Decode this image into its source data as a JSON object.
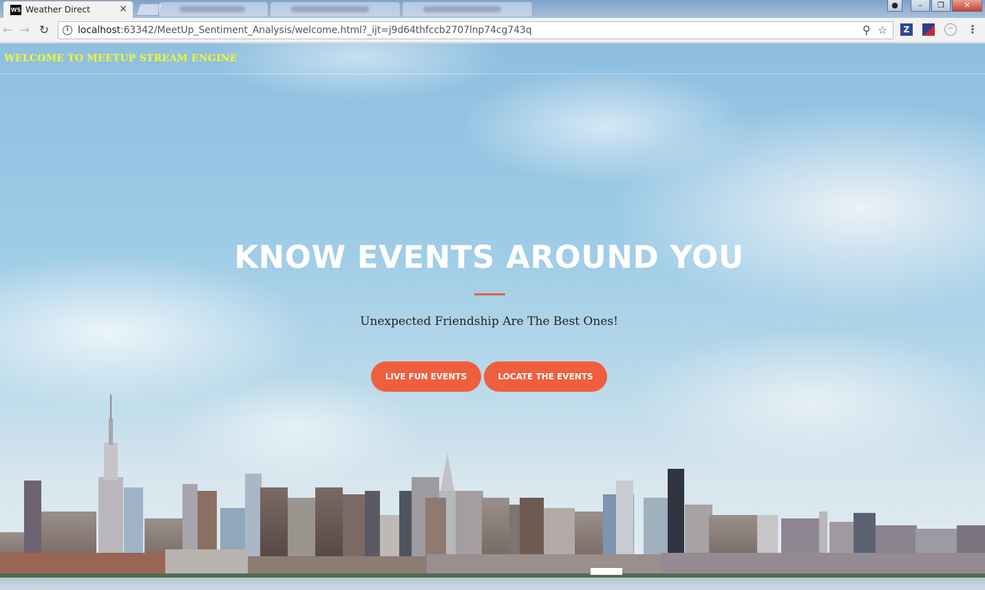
{
  "browser": {
    "active_tab": {
      "title": "Weather Direct",
      "favicon": "WS",
      "close": "×"
    },
    "address_host": "localhost",
    "address_rest": ":63342/MeetUp_Sentiment_Analysis/welcome.html?_ijt=j9d64thfccb2707lnp74cg743q",
    "extensions": {
      "z": "Z"
    },
    "icons": [
      "back-icon",
      "forward-icon",
      "reload-icon",
      "info-icon",
      "zoom-icon",
      "star-icon",
      "menu-icon"
    ]
  },
  "page": {
    "brand": "WELCOME TO MEETUP STREAM ENGINE",
    "title": "KNOW EVENTS AROUND YOU",
    "subtitle": "Unexpected Friendship Are The Best Ones!",
    "buttons": {
      "live": "LIVE FUN EVENTS",
      "locate": "LOCATE THE EVENTS"
    },
    "colors": {
      "brand": "#f4f72d",
      "accent": "#ef5e3d",
      "divider": "#e8603c"
    }
  }
}
